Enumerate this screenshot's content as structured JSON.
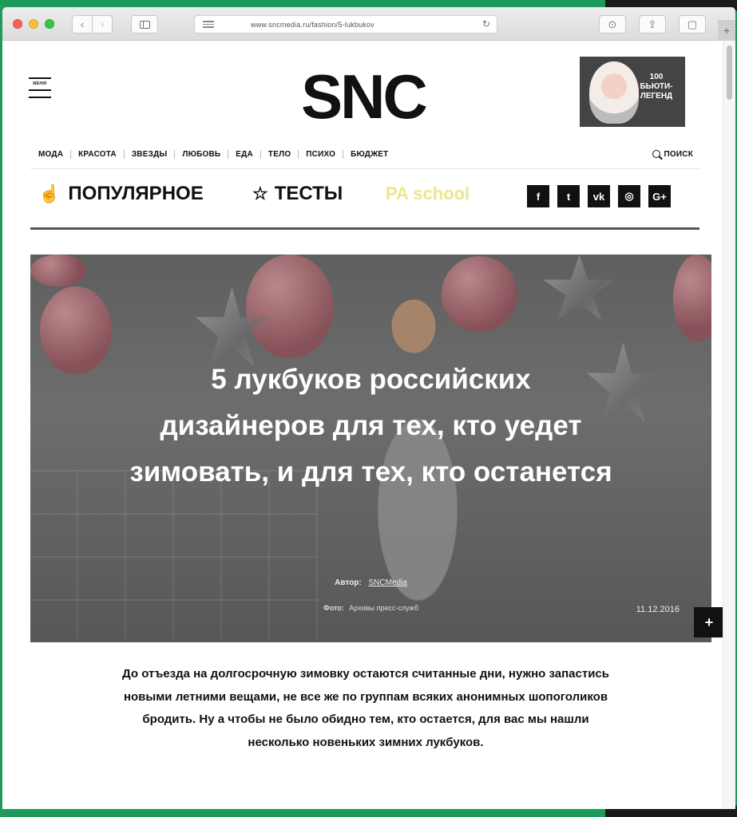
{
  "browser": {
    "url": "www.sncmedia.ru/fashion/5-lukbukov",
    "buttons": {
      "back": "‹",
      "forward": "›",
      "reload": "↻",
      "share": "⇪",
      "downloads": "⊙",
      "tabs": "▢",
      "new_tab": "+"
    }
  },
  "header": {
    "menu_label": "МЕНЮ",
    "logo": "SNC",
    "ad_text": "100 БЬЮТИ-ЛЕГЕНД"
  },
  "nav": {
    "items": [
      "МОДА",
      "КРАСОТА",
      "ЗВЕЗДЫ",
      "ЛЮБОВЬ",
      "ЕДА",
      "ТЕЛО",
      "ПСИХО",
      "БЮДЖЕТ"
    ],
    "search_label": "ПОИСК"
  },
  "sub_nav": {
    "popular": "ПОПУЛЯРНОЕ",
    "tests": "ТЕСТЫ",
    "school": "PA school",
    "social": [
      "f",
      "t",
      "vk",
      "◎",
      "G+"
    ]
  },
  "hero": {
    "title": "5 лукбуков российских дизайнеров для тех, кто уедет зимовать, и для тех, кто останется",
    "author_label": "Автор:",
    "author_name": "SNCMedia",
    "photo_label": "Фото:",
    "photo_source": "Архивы пресс-служб",
    "date": "11.12.2016",
    "plus": "+"
  },
  "article": {
    "lead": "До отъезда на долгосрочную зимовку остаются считанные дни, нужно запастись новыми летними вещами, не все же по группам всяких анонимных шопоголиков бродить. Ну а чтобы не было обидно тем, кто остается, для вас мы нашли несколько новеньких зимних лукбуков."
  }
}
